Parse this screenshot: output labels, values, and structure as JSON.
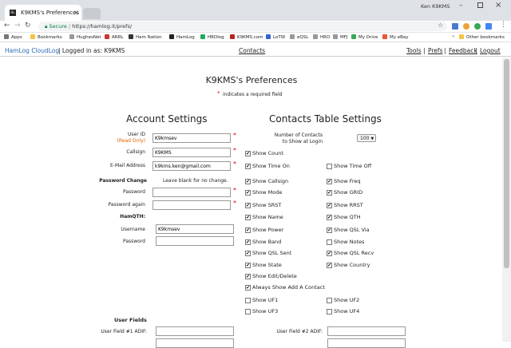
{
  "browser": {
    "tab_title": "K9KMS's Preferences",
    "tab_close": "×",
    "user_name": "Ken K9KMS",
    "secure_label": "Secure",
    "url": "https://hamlog.it/prefs/"
  },
  "bookmarks": {
    "items": [
      "Apps",
      "Bookmarks",
      "HughesNet",
      "ARRL",
      "Ham Nation",
      "HamLog",
      "HRDlog",
      "K9KMS.com",
      "LoTW",
      "eQSL",
      "HRO",
      "MFJ",
      "My Drive",
      "My eBay"
    ],
    "other": "Other bookmarks",
    "more": "»"
  },
  "nav": {
    "brand": "HamLog CloudLog",
    "logged_in": "| Logged in as: K9KMS",
    "contacts": "Contacts",
    "tools": "Tools",
    "prefs": "Prefs",
    "feedback": "Feedback",
    "logout": "Logout",
    "sep": "|"
  },
  "page": {
    "title": "K9KMS's Preferences",
    "required_note": "indicates a required field",
    "asterisk": "*"
  },
  "account": {
    "heading": "Account Settings",
    "user_id_label": "User ID",
    "read_only": "(Read Only)",
    "user_id": "K9kmsev",
    "callsign_label": "Callsign",
    "callsign": "K9KMS",
    "email_label": "E-Mail Address",
    "email": "k9kms.ken@gmail.com",
    "pw_change_label": "Password Change",
    "pw_hint": "Leave blank for no change.",
    "password_label": "Password",
    "password_again_label": "Password again",
    "hamqth_label": "HamQTH:",
    "username_label": "Username",
    "hamqth_username": "K9kmsev",
    "hamqth_password_label": "Password"
  },
  "contacts_table": {
    "heading": "Contacts Table Settings",
    "num_label_1": "Number of Contacts",
    "num_label_2": "to Show at Login",
    "num_value": "100",
    "left": [
      {
        "label": "Show Count",
        "checked": true
      },
      {
        "label": "Show Time On",
        "checked": true
      },
      {
        "label": "Show Callsign",
        "checked": true
      },
      {
        "label": "Show Mode",
        "checked": true
      },
      {
        "label": "Show SRST",
        "checked": true
      },
      {
        "label": "Show Name",
        "checked": true
      },
      {
        "label": "Show Power",
        "checked": true
      },
      {
        "label": "Show Band",
        "checked": true
      },
      {
        "label": "Show QSL Sent",
        "checked": true
      },
      {
        "label": "Show State",
        "checked": true
      },
      {
        "label": "Show Edit/Delete",
        "checked": true
      },
      {
        "label": "Always Show Add A Contact",
        "checked": true
      },
      {
        "label": "Show UF1",
        "checked": false
      },
      {
        "label": "Show UF3",
        "checked": false
      }
    ],
    "right": [
      {
        "label": "Show Time Off",
        "checked": false
      },
      {
        "label": "Show Freq",
        "checked": true
      },
      {
        "label": "Show GRID",
        "checked": true
      },
      {
        "label": "Show RRST",
        "checked": true
      },
      {
        "label": "Show QTH",
        "checked": true
      },
      {
        "label": "Show QSL Via",
        "checked": true
      },
      {
        "label": "Show Notes",
        "checked": false
      },
      {
        "label": "Show QSL Recv",
        "checked": true
      },
      {
        "label": "Show Country",
        "checked": true
      },
      {
        "label": "Show UF2",
        "checked": false
      },
      {
        "label": "Show UF4",
        "checked": false
      }
    ],
    "check_mark": "✔"
  },
  "user_fields": {
    "heading": "User Fields",
    "uf1_label": "User Field #1 ADIF:",
    "uf2_label": "User Field #2 ADIF:"
  }
}
